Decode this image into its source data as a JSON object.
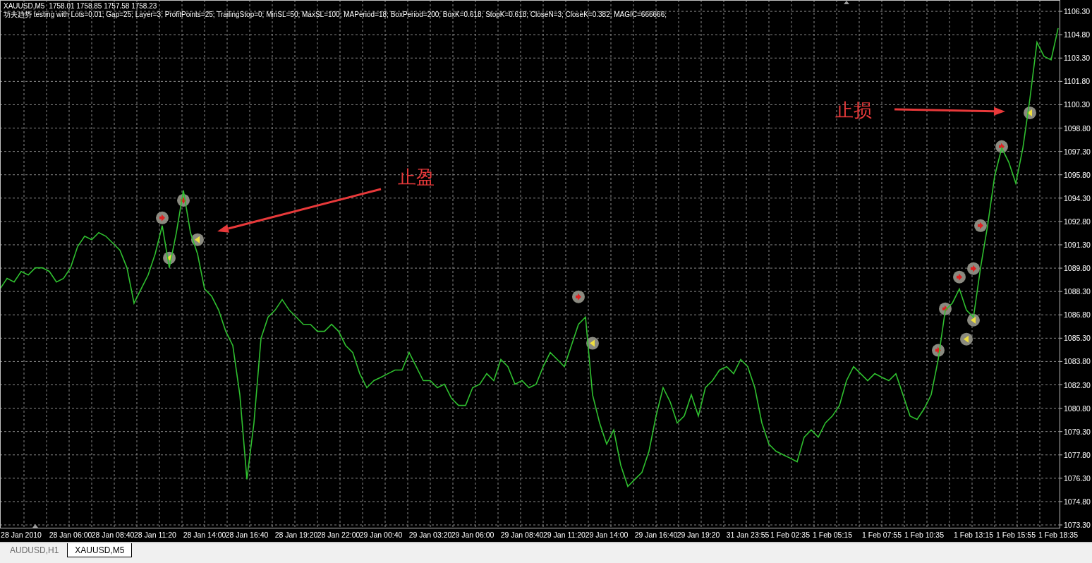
{
  "chart_header": {
    "symbol": "XAUUSD,M5",
    "quotes": "1758.01 1758.85 1757.58 1758.23",
    "description": "功夫趋势 testing with Lots=0.01; Gap=25; Layer=3; ProfitPoints=25; TrailingStop=0; MinSL=50; MaxSL=100; MAPeriod=18; BoxPeriod=200; BoxK=0.618; StopK=0.618; CloseN=3; CloseK=0.382; MAGIC=666666;"
  },
  "chart": {
    "chart_data": {
      "type": "line",
      "ylim": [
        1073.12,
        1107.03
      ],
      "yticks": [
        {
          "value": 1073.3,
          "label": "1073.30"
        },
        {
          "value": 1074.8,
          "label": "1074.80"
        },
        {
          "value": 1076.3,
          "label": "1076.30"
        },
        {
          "value": 1077.8,
          "label": "1077.80"
        },
        {
          "value": 1079.3,
          "label": "1079.30"
        },
        {
          "value": 1080.8,
          "label": "1080.80"
        },
        {
          "value": 1082.3,
          "label": "1082.30"
        },
        {
          "value": 1083.8,
          "label": "1083.80"
        },
        {
          "value": 1085.3,
          "label": "1085.30"
        },
        {
          "value": 1086.8,
          "label": "1086.80"
        },
        {
          "value": 1088.3,
          "label": "1088.30"
        },
        {
          "value": 1089.8,
          "label": "1089.80"
        },
        {
          "value": 1091.3,
          "label": "1091.30"
        },
        {
          "value": 1092.8,
          "label": "1092.80"
        },
        {
          "value": 1094.3,
          "label": "1094.30"
        },
        {
          "value": 1095.8,
          "label": "1095.80"
        },
        {
          "value": 1097.3,
          "label": "1097.30"
        },
        {
          "value": 1098.8,
          "label": "1098.80"
        },
        {
          "value": 1100.3,
          "label": "1100.30"
        },
        {
          "value": 1101.8,
          "label": "1101.80"
        },
        {
          "value": 1103.3,
          "label": "1103.30"
        },
        {
          "value": 1104.8,
          "label": "1104.80"
        },
        {
          "value": 1106.3,
          "label": "1106.30"
        }
      ],
      "grid": true,
      "categories": [
        null,
        null,
        null,
        "28 Jan 2010",
        null,
        null,
        null,
        null,
        null,
        null,
        "28 Jan 06:00",
        null,
        null,
        null,
        null,
        null,
        "28 Jan 08:40",
        null,
        null,
        null,
        null,
        null,
        "28 Jan 11:20",
        null,
        null,
        null,
        null,
        null,
        null,
        "28 Jan 14:00",
        null,
        null,
        null,
        null,
        null,
        "28 Jan 16:40",
        null,
        null,
        null,
        null,
        null,
        null,
        "28 Jan 19:20",
        null,
        null,
        null,
        null,
        null,
        "28 Jan 22:00",
        null,
        null,
        null,
        null,
        null,
        "29 Jan 00:40",
        null,
        null,
        null,
        null,
        null,
        null,
        "29 Jan 03:20",
        null,
        null,
        null,
        null,
        null,
        "29 Jan 06:00",
        null,
        null,
        null,
        null,
        null,
        null,
        "29 Jan 08:40",
        null,
        null,
        null,
        null,
        null,
        "29 Jan 11:20",
        null,
        null,
        null,
        null,
        null,
        "29 Jan 14:00",
        null,
        null,
        null,
        null,
        null,
        null,
        "29 Jan 16:40",
        null,
        null,
        null,
        null,
        null,
        "29 Jan 19:20",
        null,
        null,
        null,
        null,
        null,
        null,
        "31 Jan 23:55",
        null,
        null,
        null,
        null,
        null,
        "1 Feb 02:35",
        null,
        null,
        null,
        null,
        null,
        "1 Feb 05:15",
        null,
        null,
        null,
        null,
        null,
        null,
        "1 Feb 07:55",
        null,
        null,
        null,
        null,
        null,
        "1 Feb 10:35",
        null,
        null,
        null,
        null,
        null,
        null,
        "1 Feb 13:15",
        null,
        null,
        null,
        null,
        null,
        "1 Feb 15:55",
        null,
        null,
        null,
        null,
        null,
        "1 Feb 18:35"
      ],
      "series": [
        {
          "color": "#2fbf2f",
          "values": [
            1088.46,
            1089.14,
            1088.91,
            1089.59,
            1089.36,
            1089.82,
            1089.82,
            1089.59,
            1088.91,
            1089.14,
            1089.82,
            1091.18,
            1091.85,
            1091.63,
            1092.08,
            1091.85,
            1091.4,
            1090.95,
            1089.82,
            1087.55,
            1088.46,
            1089.36,
            1090.72,
            1092.53,
            1089.82,
            1092.08,
            1094.8,
            1092.08,
            1090.72,
            1088.46,
            1088.0,
            1087.1,
            1085.74,
            1084.83,
            1081.66,
            1076.23,
            1079.85,
            1085.29,
            1086.65,
            1087.1,
            1087.78,
            1087.1,
            1086.65,
            1086.19,
            1086.19,
            1085.74,
            1085.74,
            1086.19,
            1085.74,
            1084.83,
            1084.38,
            1083.02,
            1082.12,
            1082.57,
            1082.79,
            1083.02,
            1083.25,
            1083.25,
            1084.38,
            1083.47,
            1082.57,
            1082.57,
            1082.12,
            1082.34,
            1081.44,
            1080.98,
            1080.98,
            1082.12,
            1082.34,
            1083.02,
            1082.57,
            1083.93,
            1083.47,
            1082.34,
            1082.57,
            1082.12,
            1082.34,
            1083.47,
            1084.38,
            1083.93,
            1083.47,
            1084.83,
            1086.19,
            1086.65,
            1081.66,
            1079.85,
            1078.49,
            1079.4,
            1077.13,
            1075.77,
            1076.23,
            1076.68,
            1078.04,
            1080.3,
            1082.12,
            1081.21,
            1079.85,
            1080.3,
            1081.66,
            1080.3,
            1082.12,
            1082.57,
            1083.25,
            1083.47,
            1083.02,
            1083.93,
            1083.47,
            1082.12,
            1079.85,
            1078.49,
            1078.04,
            1077.81,
            1077.59,
            1077.36,
            1078.94,
            1079.4,
            1078.94,
            1079.85,
            1080.3,
            1080.98,
            1082.57,
            1083.47,
            1083.02,
            1082.57,
            1083.02,
            1082.79,
            1082.57,
            1083.02,
            1081.66,
            1080.3,
            1080.08,
            1080.76,
            1081.66,
            1083.93,
            1087.1,
            1087.55,
            1088.46,
            1087.1,
            1086.65,
            1089.82,
            1092.53,
            1095.71,
            1097.52,
            1096.61,
            1095.25,
            1097.52,
            1100.69,
            1104.31,
            1103.41,
            1103.18,
            1105.22
          ]
        },
        {
          "type": "scatter",
          "color": "#e02020",
          "values": [
            null,
            null,
            null,
            null,
            null,
            null,
            null,
            null,
            null,
            null,
            null,
            null,
            null,
            null,
            null,
            null,
            null,
            null,
            null,
            null,
            null,
            null,
            null,
            1093.03,
            null,
            null,
            1094.16,
            null,
            null,
            null,
            null,
            null,
            null,
            null,
            null,
            null,
            null,
            null,
            null,
            null,
            null,
            null,
            null,
            null,
            null,
            null,
            null,
            null,
            null,
            null,
            null,
            null,
            null,
            null,
            null,
            null,
            null,
            null,
            null,
            null,
            null,
            null,
            null,
            null,
            null,
            null,
            null,
            null,
            null,
            null,
            null,
            null,
            null,
            null,
            null,
            null,
            null,
            null,
            null,
            null,
            null,
            null,
            1087.96,
            null,
            null,
            null,
            null,
            null,
            null,
            null,
            null,
            null,
            null,
            null,
            null,
            null,
            null,
            null,
            null,
            null,
            null,
            null,
            null,
            null,
            null,
            null,
            null,
            null,
            null,
            null,
            null,
            null,
            null,
            null,
            null,
            null,
            null,
            null,
            null,
            null,
            null,
            null,
            null,
            null,
            null,
            null,
            null,
            null,
            null,
            null,
            null,
            null,
            null,
            1084.52,
            1087.19,
            null,
            1089.23,
            null,
            1089.77,
            1092.53,
            null,
            null,
            1097.61,
            null,
            null,
            null,
            null,
            null,
            null,
            null,
            null
          ]
        },
        {
          "type": "scatter",
          "color": "#f0e040",
          "values": [
            null,
            null,
            null,
            null,
            null,
            null,
            null,
            null,
            null,
            null,
            null,
            null,
            null,
            null,
            null,
            null,
            null,
            null,
            null,
            null,
            null,
            null,
            null,
            null,
            1090.45,
            null,
            null,
            null,
            1091.63,
            null,
            null,
            null,
            null,
            null,
            null,
            null,
            null,
            null,
            null,
            null,
            null,
            null,
            null,
            null,
            null,
            null,
            null,
            null,
            null,
            null,
            null,
            null,
            null,
            null,
            null,
            null,
            null,
            null,
            null,
            null,
            null,
            null,
            null,
            null,
            null,
            null,
            null,
            null,
            null,
            null,
            null,
            null,
            null,
            null,
            null,
            null,
            null,
            null,
            null,
            null,
            null,
            null,
            null,
            null,
            1084.97,
            null,
            null,
            null,
            null,
            null,
            null,
            null,
            null,
            null,
            null,
            null,
            null,
            null,
            null,
            null,
            null,
            null,
            null,
            null,
            null,
            null,
            null,
            null,
            null,
            null,
            null,
            null,
            null,
            null,
            null,
            null,
            null,
            null,
            null,
            null,
            null,
            null,
            null,
            null,
            null,
            null,
            null,
            null,
            null,
            null,
            null,
            null,
            null,
            null,
            null,
            null,
            null,
            1085.24,
            1086.46,
            null,
            null,
            null,
            null,
            null,
            null,
            null,
            1099.78,
            null,
            null,
            null,
            null
          ]
        }
      ],
      "annotations": [
        "止盈",
        "止损"
      ]
    }
  },
  "tabs": [
    {
      "label": "AUDUSD,H1",
      "selected": false
    },
    {
      "label": "XAUUSD,M5",
      "selected": true
    }
  ]
}
